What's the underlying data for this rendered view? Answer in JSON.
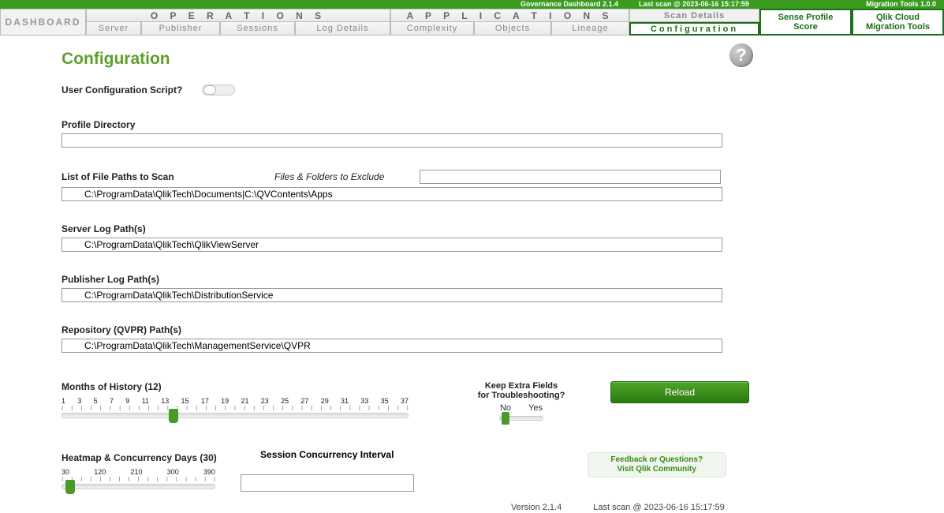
{
  "topbar": {
    "product": "Governance Dashboard 2.1.4",
    "last_scan": "Last scan @ 2023-06-16 15:17:59",
    "migration": "Migration Tools 1.0.0"
  },
  "nav": {
    "dashboard": "DASHBOARD",
    "operations": "O P E R A T I O N S",
    "applications": "A P P L I C A T I O N S",
    "scan_details": "Scan Details",
    "sense_profile_1": "Sense Profile",
    "sense_profile_2": "Score",
    "qlik_cloud_1": "Qlik Cloud",
    "qlik_cloud_2": "Migration Tools",
    "server": "Server",
    "publisher": "Publisher",
    "sessions": "Sessions",
    "log_details": "Log Details",
    "complexity": "Complexity",
    "objects": "Objects",
    "lineage": "Lineage",
    "configuration": "Configuration"
  },
  "page": {
    "title": "Configuration",
    "user_config_label": "User Configuration Script?",
    "profile_dir_label": "Profile Directory",
    "profile_dir_value": "",
    "file_paths_label": "List of File Paths to Scan",
    "files_exclude_label": "Files & Folders to Exclude",
    "files_exclude_value": "",
    "file_paths_value": "C:\\ProgramData\\QlikTech\\Documents|C:\\QVContents\\Apps",
    "server_log_label": "Server Log Path(s)",
    "server_log_value": "C:\\ProgramData\\QlikTech\\QlikViewServer",
    "publisher_log_label": "Publisher Log Path(s)",
    "publisher_log_value": "C:\\ProgramData\\QlikTech\\DistributionService",
    "repo_label": "Repository (QVPR) Path(s)",
    "repo_value": "C:\\ProgramData\\QlikTech\\ManagementService\\QVPR",
    "months_label": "Months of History (12)",
    "months_ticks": [
      "1",
      "3",
      "5",
      "7",
      "9",
      "11",
      "13",
      "15",
      "17",
      "19",
      "21",
      "23",
      "25",
      "27",
      "29",
      "31",
      "33",
      "35",
      "37"
    ],
    "keep_extra_1": "Keep Extra Fields",
    "keep_extra_2": "for Troubleshooting?",
    "no_label": "No",
    "yes_label": "Yes",
    "reload_label": "Reload",
    "heatmap_label": "Heatmap & Concurrency Days (30)",
    "heatmap_ticks": [
      "30",
      "120",
      "210",
      "300",
      "390"
    ],
    "session_interval_label": "Session Concurrency Interval",
    "feedback_1": "Feedback or Questions?",
    "feedback_2": "Visit Qlik Community",
    "version": "Version 2.1.4",
    "footer_scan": "Last scan @ 2023-06-16 15:17:59"
  }
}
